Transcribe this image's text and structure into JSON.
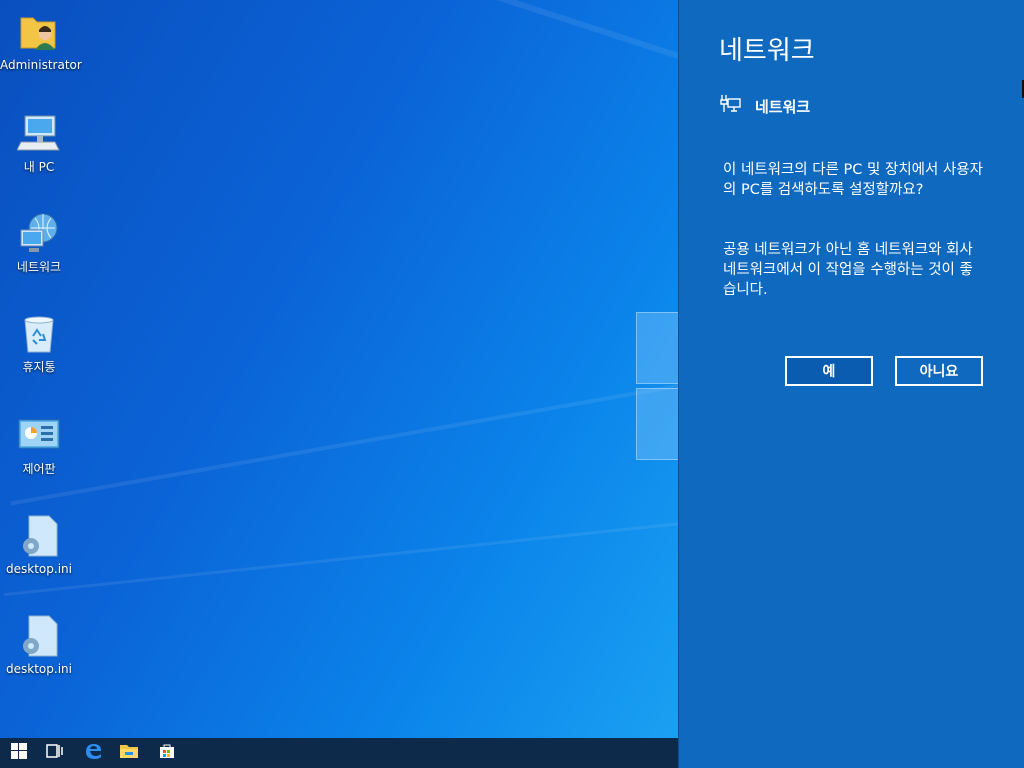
{
  "desktop": {
    "icons": [
      {
        "label": "Administrator",
        "icon": "user-folder-icon"
      },
      {
        "label": "내 PC",
        "icon": "computer-icon"
      },
      {
        "label": "네트워크",
        "icon": "network-icon"
      },
      {
        "label": "휴지통",
        "icon": "recycle-bin-icon"
      },
      {
        "label": "제어판",
        "icon": "control-panel-icon"
      },
      {
        "label": "desktop.ini",
        "icon": "settings-file-icon"
      },
      {
        "label": "desktop.ini",
        "icon": "settings-file-icon"
      }
    ]
  },
  "taskbar": {
    "items": [
      {
        "icon": "windows-start-icon"
      },
      {
        "icon": "task-view-icon"
      },
      {
        "icon": "edge-browser-icon"
      },
      {
        "icon": "file-explorer-icon"
      },
      {
        "icon": "store-icon"
      }
    ]
  },
  "flyout": {
    "title": "네트워크",
    "network_name": "네트워크",
    "network_icon": "ethernet-icon",
    "question": "이 네트워크의 다른 PC 및 장치에서 사용자의 PC를 검색하도록 설정할까요?",
    "advice": "공용 네트워크가 아닌 홈 네트워크와 회사 네트워크에서 이 작업을 수행하는 것이 좋습니다.",
    "yes_label": "예",
    "no_label": "아니요"
  },
  "colors": {
    "flyout_bg": "#0f69bf",
    "taskbar_bg": "#0e2a4a"
  }
}
